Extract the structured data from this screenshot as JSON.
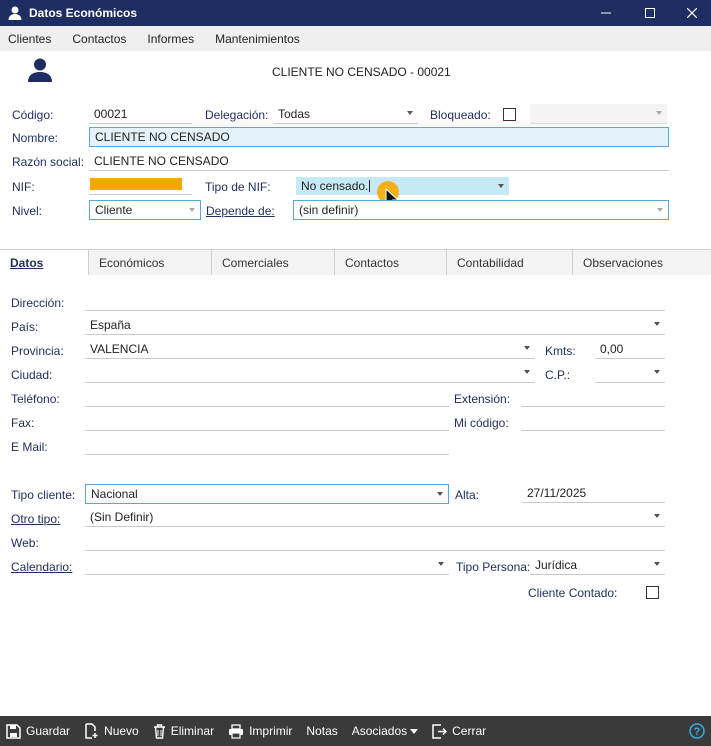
{
  "window": {
    "title": "Datos Económicos"
  },
  "menu": [
    "Clientes",
    "Contactos",
    "Informes",
    "Mantenimientos"
  ],
  "header": {
    "title": "CLIENTE NO CENSADO - 00021"
  },
  "form": {
    "codigo_label": "Código:",
    "codigo_value": "00021",
    "delegacion_label": "Delegación:",
    "delegacion_value": "Todas",
    "bloqueado_label": "Bloqueado:",
    "nombre_label": "Nombre:",
    "nombre_value": "CLIENTE NO CENSADO",
    "razon_label": "Razón social:",
    "razon_value": "CLIENTE NO CENSADO",
    "nif_label": "NIF:",
    "tiponif_label": "Tipo de NIF:",
    "tiponif_value": "No censado.",
    "nivel_label": "Nivel:",
    "nivel_value": "Cliente",
    "depende_label": "Depende de:",
    "depende_value": "(sin definir)"
  },
  "tabs": [
    "Datos",
    "Económicos",
    "Comerciales",
    "Contactos",
    "Contabilidad",
    "Observaciones"
  ],
  "datos": {
    "direccion_label": "Dirección:",
    "pais_label": "País:",
    "pais_value": "España",
    "provincia_label": "Provincia:",
    "provincia_value": "VALENCIA",
    "kmts_label": "Kmts:",
    "kmts_value": "0,00",
    "ciudad_label": "Ciudad:",
    "cp_label": "C.P.:",
    "telefono_label": "Teléfono:",
    "extension_label": "Extensión:",
    "fax_label": "Fax:",
    "micodigo_label": "Mi código:",
    "email_label": "E Mail:",
    "tipocliente_label": "Tipo cliente:",
    "tipocliente_value": "Nacional",
    "alta_label": "Alta:",
    "alta_value": "27/11/2025",
    "otrotipo_label": "Otro tipo:",
    "otrotipo_value": "(Sin Definir)",
    "web_label": "Web:",
    "calendario_label": "Calendario:",
    "tipopersona_label": "Tipo Persona:",
    "tipopersona_value": "Jurídica",
    "contado_label": "Cliente Contado:"
  },
  "footer": {
    "guardar": "Guardar",
    "nuevo": "Nuevo",
    "eliminar": "Eliminar",
    "imprimir": "Imprimir",
    "notas": "Notas",
    "asociados": "Asociados",
    "cerrar": "Cerrar"
  },
  "colors": {
    "titlebar": "#1e2e63",
    "accent": "#5aa6d6",
    "nif_bar": "#f5a800",
    "cursor_dot": "#f5a800",
    "footer": "#3a3a3a"
  }
}
